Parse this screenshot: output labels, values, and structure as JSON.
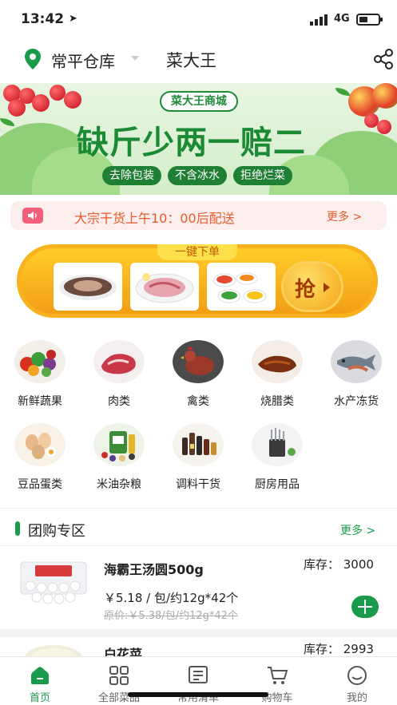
{
  "status": {
    "time": "13:42",
    "network": "4G"
  },
  "header": {
    "warehouse": "常平仓库",
    "brand": "菜大王"
  },
  "banner": {
    "shop_tag": "菜大王商城",
    "slogan": "缺斤少两一赔二",
    "pills": [
      "去除包装",
      "不含冰水",
      "拒绝烂菜"
    ]
  },
  "notice": {
    "text": "大宗干货上午10：00后配送",
    "more": "更多 >"
  },
  "onekey": {
    "title": "一键下单",
    "grab": "抢"
  },
  "categories": [
    {
      "label": "新鲜蔬果",
      "icon": "vegetables-icon"
    },
    {
      "label": "肉类",
      "icon": "meat-icon"
    },
    {
      "label": "禽类",
      "icon": "poultry-icon"
    },
    {
      "label": "烧腊类",
      "icon": "roast-meat-icon"
    },
    {
      "label": "水产冻货",
      "icon": "seafood-icon"
    },
    {
      "label": "豆品蛋类",
      "icon": "eggs-icon"
    },
    {
      "label": "米油杂粮",
      "icon": "rice-oil-icon"
    },
    {
      "label": "调料干货",
      "icon": "condiments-icon"
    },
    {
      "label": "厨房用品",
      "icon": "kitchenware-icon"
    }
  ],
  "group": {
    "title": "团购专区",
    "more": "更多 >",
    "items": [
      {
        "name": "海霸王汤圆500g",
        "stock": "库存：  3000",
        "price": "￥5.18 / 包/约12g*42个",
        "orig": "原价:￥5.38/包/约12g*42个"
      },
      {
        "name": "白花菜",
        "stock": "库存：  2993"
      }
    ]
  },
  "tabs": [
    {
      "label": "首页",
      "icon": "home-icon",
      "active": true
    },
    {
      "label": "全部菜品",
      "icon": "grid-icon",
      "active": false
    },
    {
      "label": "常用清单",
      "icon": "list-icon",
      "active": false
    },
    {
      "label": "购物车",
      "icon": "cart-icon",
      "active": false
    },
    {
      "label": "我的",
      "icon": "profile-icon",
      "active": false
    }
  ],
  "colors": {
    "brand_green": "#1a9b4c",
    "notice_orange": "#e55b2c",
    "banner_green": "#1c8a35"
  }
}
